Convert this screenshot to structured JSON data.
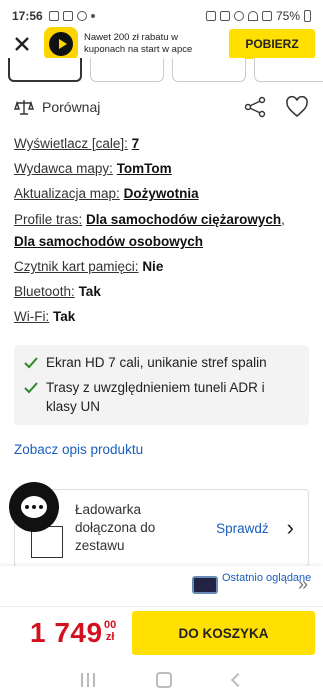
{
  "status_bar": {
    "time": "17:56",
    "battery": "75%"
  },
  "app_banner": {
    "text": "Nawet 200 zł rabatu w kuponach na start w apce",
    "button": "POBIERZ",
    "accent_color": "#ffe000"
  },
  "compare": {
    "label": "Porównaj"
  },
  "specs": [
    {
      "key": "Wyświetlacz [cale]:",
      "value": "7"
    },
    {
      "key": "Wydawca mapy:",
      "value": "TomTom"
    },
    {
      "key": "Aktualizacja map:",
      "value": "Dożywotnia"
    },
    {
      "key": "Profile tras:",
      "value_a": "Dla samochodów ciężarowych",
      "value_b": "Dla samochodów osobowych"
    },
    {
      "key": "Czytnik kart pamięci:",
      "value": "Nie"
    },
    {
      "key": "Bluetooth:",
      "value": "Tak"
    },
    {
      "key": "Wi-Fi:",
      "value": "Tak"
    }
  ],
  "features": [
    "Ekran HD 7 cali, unikanie stref spalin",
    "Trasy z uwzględnieniem tuneli ADR i klasy UN"
  ],
  "description_link": "Zobacz opis produktu",
  "charger": {
    "label": "Ładowarka dołączona do zestawu",
    "action": "Sprawdź"
  },
  "recent": {
    "label": "Ostatnio oglądane"
  },
  "buy": {
    "price_main": "1 749",
    "price_cents": "00",
    "currency": "zł",
    "button": "DO KOSZYKA",
    "price_color": "#d3101f"
  }
}
